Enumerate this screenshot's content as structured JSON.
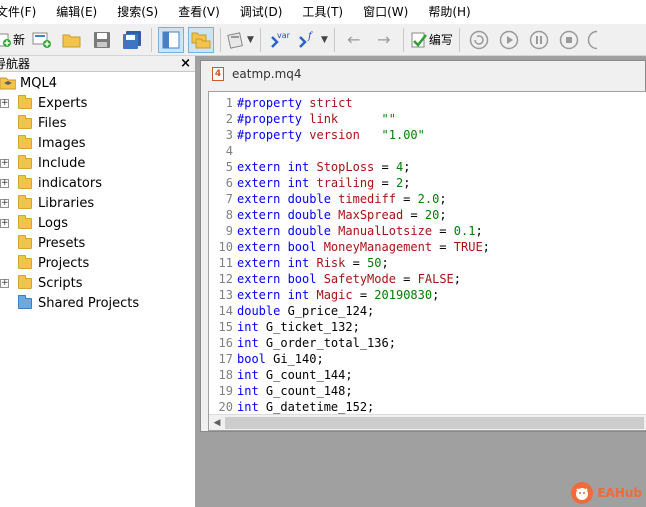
{
  "menu": [
    "文件(F)",
    "编辑(E)",
    "搜索(S)",
    "查看(V)",
    "调试(D)",
    "工具(T)",
    "窗口(W)",
    "帮助(H)"
  ],
  "toolbar": {
    "new_label": "新",
    "compile_label": "编写",
    "var_label": "var",
    "func_label": "f"
  },
  "navigator": {
    "title": "导航器",
    "close": "×",
    "root": "MQL4",
    "items": [
      {
        "label": "Experts",
        "expandable": true
      },
      {
        "label": "Files",
        "expandable": false
      },
      {
        "label": "Images",
        "expandable": false
      },
      {
        "label": "Include",
        "expandable": true
      },
      {
        "label": "indicators",
        "expandable": true
      },
      {
        "label": "Libraries",
        "expandable": true
      },
      {
        "label": "Logs",
        "expandable": true
      },
      {
        "label": "Presets",
        "expandable": false
      },
      {
        "label": "Projects",
        "expandable": false
      },
      {
        "label": "Scripts",
        "expandable": true
      },
      {
        "label": "Shared Projects",
        "expandable": false
      }
    ]
  },
  "editor": {
    "tab_title": "eatmp.mq4",
    "file_icon_text": "4",
    "lines": [
      {
        "n": "1",
        "tokens": [
          [
            "kw",
            "#property "
          ],
          [
            "nm",
            "strict"
          ]
        ]
      },
      {
        "n": "2",
        "tokens": [
          [
            "kw",
            "#property "
          ],
          [
            "nm",
            "link"
          ],
          [
            "ident",
            "      "
          ],
          [
            "str",
            "\"\""
          ]
        ]
      },
      {
        "n": "3",
        "tokens": [
          [
            "kw",
            "#property "
          ],
          [
            "nm",
            "version"
          ],
          [
            "ident",
            "   "
          ],
          [
            "str",
            "\"1.00\""
          ]
        ]
      },
      {
        "n": "4",
        "tokens": []
      },
      {
        "n": "5",
        "tokens": [
          [
            "kw",
            "extern int "
          ],
          [
            "nm",
            "StopLoss"
          ],
          [
            "ident",
            " = "
          ],
          [
            "val",
            "4"
          ],
          [
            "ident",
            ";"
          ]
        ]
      },
      {
        "n": "6",
        "tokens": [
          [
            "kw",
            "extern int "
          ],
          [
            "nm",
            "trailing"
          ],
          [
            "ident",
            " = "
          ],
          [
            "val",
            "2"
          ],
          [
            "ident",
            ";"
          ]
        ]
      },
      {
        "n": "7",
        "tokens": [
          [
            "kw",
            "extern double "
          ],
          [
            "nm",
            "timediff"
          ],
          [
            "ident",
            " = "
          ],
          [
            "val",
            "2.0"
          ],
          [
            "ident",
            ";"
          ]
        ]
      },
      {
        "n": "8",
        "tokens": [
          [
            "kw",
            "extern double "
          ],
          [
            "nm",
            "MaxSpread"
          ],
          [
            "ident",
            " = "
          ],
          [
            "val",
            "20"
          ],
          [
            "ident",
            ";"
          ]
        ]
      },
      {
        "n": "9",
        "tokens": [
          [
            "kw",
            "extern double "
          ],
          [
            "nm",
            "ManualLotsize"
          ],
          [
            "ident",
            " = "
          ],
          [
            "val",
            "0.1"
          ],
          [
            "ident",
            ";"
          ]
        ]
      },
      {
        "n": "10",
        "tokens": [
          [
            "kw",
            "extern bool "
          ],
          [
            "nm",
            "MoneyManagement"
          ],
          [
            "ident",
            " = "
          ],
          [
            "const",
            "TRUE"
          ],
          [
            "ident",
            ";"
          ]
        ]
      },
      {
        "n": "11",
        "tokens": [
          [
            "kw",
            "extern int "
          ],
          [
            "nm",
            "Risk"
          ],
          [
            "ident",
            " = "
          ],
          [
            "val",
            "50"
          ],
          [
            "ident",
            ";"
          ]
        ]
      },
      {
        "n": "12",
        "tokens": [
          [
            "kw",
            "extern bool "
          ],
          [
            "nm",
            "SafetyMode"
          ],
          [
            "ident",
            " = "
          ],
          [
            "const",
            "FALSE"
          ],
          [
            "ident",
            ";"
          ]
        ]
      },
      {
        "n": "13",
        "tokens": [
          [
            "kw",
            "extern int "
          ],
          [
            "nm",
            "Magic"
          ],
          [
            "ident",
            " = "
          ],
          [
            "val",
            "20190830"
          ],
          [
            "ident",
            ";"
          ]
        ]
      },
      {
        "n": "14",
        "tokens": [
          [
            "kw",
            "double "
          ],
          [
            "ident",
            "G_price_124;"
          ]
        ]
      },
      {
        "n": "15",
        "tokens": [
          [
            "kw",
            "int "
          ],
          [
            "ident",
            "G_ticket_132;"
          ]
        ]
      },
      {
        "n": "16",
        "tokens": [
          [
            "kw",
            "int "
          ],
          [
            "ident",
            "G_order_total_136;"
          ]
        ]
      },
      {
        "n": "17",
        "tokens": [
          [
            "kw",
            "bool "
          ],
          [
            "ident",
            "Gi_140;"
          ]
        ]
      },
      {
        "n": "18",
        "tokens": [
          [
            "kw",
            "int "
          ],
          [
            "ident",
            "G_count_144;"
          ]
        ]
      },
      {
        "n": "19",
        "tokens": [
          [
            "kw",
            "int "
          ],
          [
            "ident",
            "G_count_148;"
          ]
        ]
      },
      {
        "n": "20",
        "tokens": [
          [
            "kw",
            "int "
          ],
          [
            "ident",
            "G_datetime_152;"
          ]
        ]
      }
    ]
  },
  "watermark": {
    "text": "EAHub"
  },
  "colors": {
    "accent": "#0000ff",
    "identifier": "#a31515",
    "value": "#008000"
  }
}
